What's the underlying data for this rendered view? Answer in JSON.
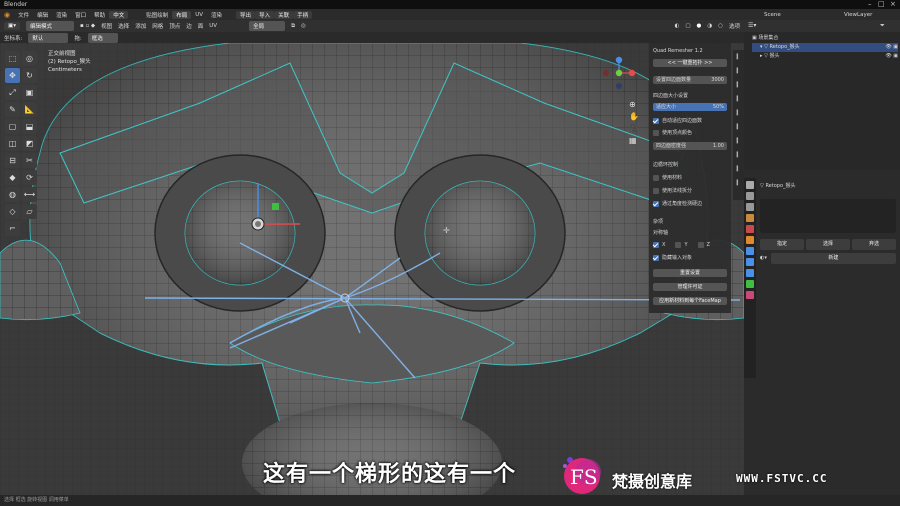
{
  "titlebar": {
    "app_name": "Blender"
  },
  "menu": {
    "items": [
      "文件",
      "编辑",
      "渲染",
      "窗口",
      "帮助"
    ],
    "lang_badge": "中文",
    "workspaces": [
      "贴图绘制",
      "布局",
      "UV",
      "渲染"
    ],
    "active_workspace_index": 1,
    "top_buttons": [
      "导出",
      "导入",
      "关联",
      "手柄"
    ],
    "scene_label": "Scene",
    "view_layer_label": "ViewLayer"
  },
  "header": {
    "mode": "编辑模式",
    "view_menus": [
      "视图",
      "选择",
      "添加",
      "网格",
      "顶点",
      "边",
      "面",
      "UV"
    ],
    "transform_orientation": "全局",
    "options": "选项"
  },
  "header2": {
    "orientation_label": "坐标系:",
    "orientation_value": "默认",
    "drag_label": "拖:",
    "drag_value": "框选"
  },
  "viewport": {
    "view_name": "正交前视图",
    "object_label": "(2) Retopo_猴头",
    "units": "Centimeters"
  },
  "npanel": {
    "title": "Quad Remesher 1.2",
    "remesh_button": "<< 一键重拓扑 >>",
    "target_count_label": "设置四边面数量",
    "target_count_value": "3000",
    "quad_size_section": "四边面大小设置",
    "adaptive_size_label": "适应大小",
    "adaptive_size_value": "50%",
    "checkboxes": [
      {
        "label": "自动适应四边面数",
        "checked": true
      },
      {
        "label": "使用顶点颜色",
        "checked": false
      }
    ],
    "density_label": "四边面密度强",
    "density_value": "1.00",
    "edge_loops_section": "边循环控制",
    "edge_loops": [
      {
        "label": "使用材料",
        "checked": false
      },
      {
        "label": "使用法线拆分",
        "checked": false
      },
      {
        "label": "通过角度检测硬边",
        "checked": true
      }
    ],
    "misc_section": "杂项",
    "symmetry_label": "对称轴",
    "axes": [
      {
        "label": "X",
        "checked": true
      },
      {
        "label": "Y",
        "checked": false
      },
      {
        "label": "Z",
        "checked": false
      }
    ],
    "hide_input": {
      "label": "隐藏输入对象",
      "checked": true
    },
    "reset_button": "重置设置",
    "license_button": "管理许可证",
    "facemap_button": "应用新材料到每个FaceMap"
  },
  "outliner": {
    "collection_label": "场景集合",
    "items": [
      {
        "label": "Retopo_猴头",
        "selected": true
      },
      {
        "label": "猴头",
        "selected": false
      }
    ]
  },
  "properties": {
    "object_name": "Retopo_猴头",
    "buttons": [
      "指定",
      "选择",
      "弃选"
    ],
    "new_button": "新建"
  },
  "subtitle": "这有一个梯形的这有一个",
  "watermark": {
    "logo_letters": "FS",
    "cn_name": "梵摄创意库",
    "url": "WWW.FSTVC.CC"
  },
  "status": {
    "text": "选择    框选    旋转视图    调用菜单"
  },
  "colors": {
    "accent": "#4772b3",
    "mesh_edge": "#3ec7c7",
    "subtitle": "#ffffff",
    "logo_pink": "#e0287a",
    "logo_purple": "#7a3fd6"
  }
}
